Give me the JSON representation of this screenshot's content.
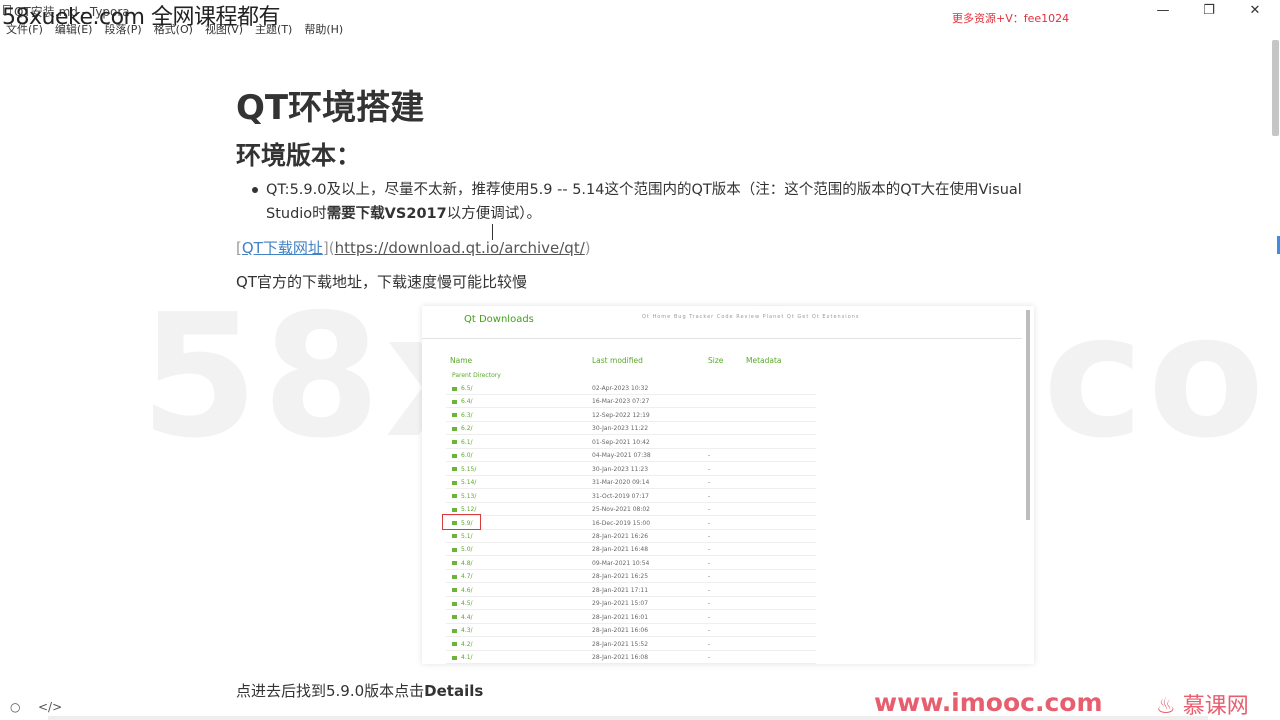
{
  "window": {
    "title": "QT安装.md - Typora",
    "watermark": "58xueke.com 全网课程都有",
    "promo": "更多资源+V：fee1024",
    "min_icon": "minimize-icon",
    "max_icon": "restore-icon",
    "close_icon": "close-icon"
  },
  "menu": [
    {
      "label": "文件(F)"
    },
    {
      "label": "编辑(E)"
    },
    {
      "label": "段落(P)"
    },
    {
      "label": "格式(O)"
    },
    {
      "label": "视图(V)"
    },
    {
      "label": "主题(T)"
    },
    {
      "label": "帮助(H)"
    }
  ],
  "doc": {
    "h1": "QT环境搭建",
    "h2": "环境版本：",
    "bullet_prefix": "QT:5.9.0及以上，尽量不太新，推荐使用5.9 -- 5.14这个范围内的QT版本（注：这个范围的版本的QT大在使用Visual Studio时",
    "bullet_bold": "需要下载VS2017",
    "bullet_suffix": "以方便调试）。",
    "link_open": "[",
    "link_text": "QT下载网址",
    "link_mid": "](",
    "link_url": "https://download.qt.io/archive/qt/",
    "link_close": ")",
    "para1": "QT官方的下载地址，下载速度慢可能比较慢",
    "para2_prefix": "点进去后找到5.9.0版本点击",
    "para2_bold": "Details"
  },
  "embedded": {
    "title": "Qt Downloads",
    "nav": "Qt Home    Bug Tracker    Code Review    Planet Qt    Get Qt Extensions",
    "col_name": "Name",
    "col_modified": "Last modified",
    "col_size": "Size",
    "col_meta": "Metadata",
    "parent": "Parent Directory",
    "rows": [
      {
        "name": "6.5/",
        "date": "02-Apr-2023 10:32",
        "size": ""
      },
      {
        "name": "6.4/",
        "date": "16-Mar-2023 07:27",
        "size": ""
      },
      {
        "name": "6.3/",
        "date": "12-Sep-2022 12:19",
        "size": ""
      },
      {
        "name": "6.2/",
        "date": "30-Jan-2023 11:22",
        "size": ""
      },
      {
        "name": "6.1/",
        "date": "01-Sep-2021 10:42",
        "size": ""
      },
      {
        "name": "6.0/",
        "date": "04-May-2021 07:38",
        "size": "-"
      },
      {
        "name": "5.15/",
        "date": "30-Jan-2023 11:23",
        "size": "-"
      },
      {
        "name": "5.14/",
        "date": "31-Mar-2020 09:14",
        "size": "-"
      },
      {
        "name": "5.13/",
        "date": "31-Oct-2019 07:17",
        "size": "-"
      },
      {
        "name": "5.12/",
        "date": "25-Nov-2021 08:02",
        "size": "-"
      },
      {
        "name": "5.9/",
        "date": "16-Dec-2019 15:00",
        "size": "-"
      },
      {
        "name": "5.1/",
        "date": "28-Jan-2021 16:26",
        "size": "-"
      },
      {
        "name": "5.0/",
        "date": "28-Jan-2021 16:48",
        "size": "-"
      },
      {
        "name": "4.8/",
        "date": "09-Mar-2021 10:54",
        "size": "-"
      },
      {
        "name": "4.7/",
        "date": "28-Jan-2021 16:25",
        "size": "-"
      },
      {
        "name": "4.6/",
        "date": "28-Jan-2021 17:11",
        "size": "-"
      },
      {
        "name": "4.5/",
        "date": "29-Jan-2021 15:07",
        "size": "-"
      },
      {
        "name": "4.4/",
        "date": "28-Jan-2021 16:01",
        "size": "-"
      },
      {
        "name": "4.3/",
        "date": "28-Jan-2021 16:06",
        "size": "-"
      },
      {
        "name": "4.2/",
        "date": "28-Jan-2021 15:52",
        "size": "-"
      },
      {
        "name": "4.1/",
        "date": "28-Jan-2021 16:08",
        "size": "-"
      }
    ]
  },
  "overlay": {
    "big_watermark": "58xueke.com",
    "brand_url": "www.imooc.com",
    "brand_name": "慕课网"
  },
  "status": {
    "outline_icon": "circle-icon",
    "source_icon": "code-icon",
    "source_label": "</>"
  },
  "colors": {
    "link": "#4183c4",
    "qt_green": "#41a317",
    "highlight": "#d93a3a",
    "brand": "#e03246",
    "promo": "#e0313b"
  }
}
